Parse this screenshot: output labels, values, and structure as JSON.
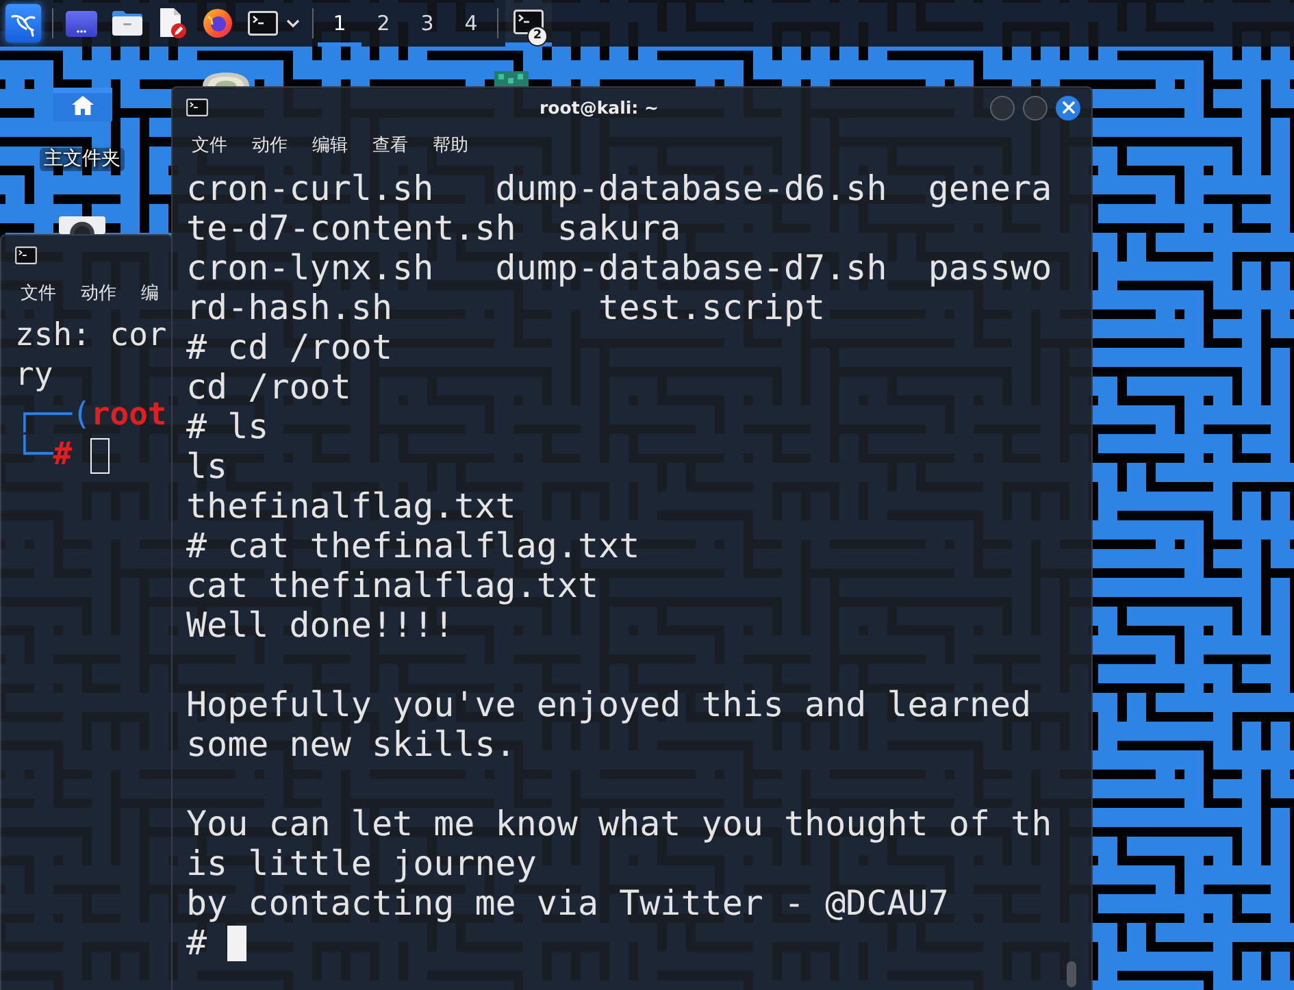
{
  "taskbar": {
    "launchers": [
      {
        "kind": "desktop"
      },
      {
        "kind": "files"
      },
      {
        "kind": "editor"
      },
      {
        "kind": "browser"
      },
      {
        "kind": "terminal"
      }
    ],
    "workspaces": [
      {
        "label": "1",
        "selected": true
      },
      {
        "label": "2",
        "selected": false
      },
      {
        "label": "3",
        "selected": false
      },
      {
        "label": "4",
        "selected": false
      }
    ],
    "tasks": [
      {
        "kind": "terminal",
        "badge": "2",
        "active": true
      }
    ]
  },
  "desktop_icons": [
    {
      "kind": "home",
      "label": "主文件夹"
    },
    {
      "kind": "trash"
    },
    {
      "kind": "app"
    },
    {
      "kind": "drive"
    }
  ],
  "windows": [
    {
      "kind": "terminal",
      "active": false,
      "menu": [
        "文件",
        "动作",
        "编"
      ],
      "lines": [
        {
          "kind": "text",
          "text": "zsh: cor"
        },
        {
          "kind": "text",
          "text": "ry"
        },
        {
          "kind": "zsh_top",
          "frame": "┌──(",
          "user": "root"
        },
        {
          "kind": "zsh_bottom",
          "frame": "└─",
          "symbol": "#"
        }
      ]
    },
    {
      "kind": "terminal",
      "active": true,
      "title": "root@kali: ~",
      "menu": [
        "文件",
        "动作",
        "编辑",
        "查看",
        "帮助"
      ],
      "lines": [
        {
          "kind": "text",
          "text": "cron-curl.sh   dump-database-d6.sh  genera"
        },
        {
          "kind": "text",
          "text": "te-d7-content.sh  sakura"
        },
        {
          "kind": "text",
          "text": "cron-lynx.sh   dump-database-d7.sh  passwo"
        },
        {
          "kind": "text",
          "text": "rd-hash.sh          test.script"
        },
        {
          "kind": "text",
          "text": "# cd /root"
        },
        {
          "kind": "text",
          "text": "cd /root"
        },
        {
          "kind": "text",
          "text": "# ls"
        },
        {
          "kind": "text",
          "text": "ls"
        },
        {
          "kind": "text",
          "text": "thefinalflag.txt"
        },
        {
          "kind": "text",
          "text": "# cat thefinalflag.txt"
        },
        {
          "kind": "text",
          "text": "cat thefinalflag.txt"
        },
        {
          "kind": "text",
          "text": "Well done!!!!"
        },
        {
          "kind": "blank"
        },
        {
          "kind": "text",
          "text": "Hopefully you've enjoyed this and learned"
        },
        {
          "kind": "text",
          "text": "some new skills."
        },
        {
          "kind": "blank"
        },
        {
          "kind": "text",
          "text": "You can let me know what you thought of th"
        },
        {
          "kind": "text",
          "text": "is little journey"
        },
        {
          "kind": "text",
          "text": "by contacting me via Twitter - @DCAU7"
        },
        {
          "kind": "prompt",
          "symbol": "#"
        }
      ]
    }
  ]
}
